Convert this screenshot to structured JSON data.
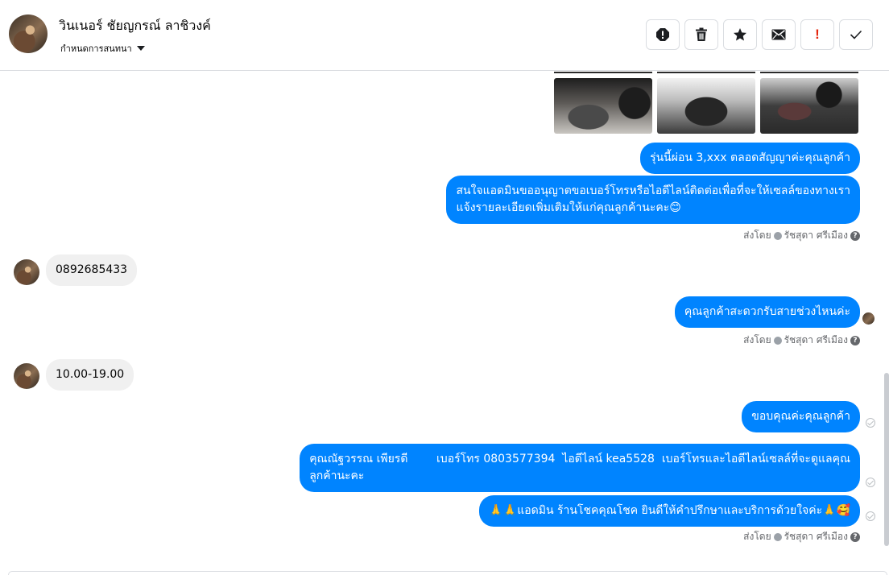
{
  "header": {
    "contact_name": "วินเนอร์ ชัยญกรณ์ ลาชิวงค์",
    "subtitle": "กำหนดการสนทนา",
    "actions": [
      {
        "name": "report-icon"
      },
      {
        "name": "trash-icon"
      },
      {
        "name": "star-icon"
      },
      {
        "name": "envelope-icon"
      },
      {
        "name": "priority-icon",
        "glyph": "!"
      },
      {
        "name": "checkmark-icon"
      }
    ]
  },
  "messages": {
    "m1": "รุ่นนี้ผ่อน 3,xxx ตลอดสัญญาค่ะคุณลูกค้า",
    "m2_line1": "สนใจแอดมินขออนุญาตขอเบอร์โทรหรือไอดีไลน์ติดต่อเพื่อที่จะให้เซลล์ของทางเรา",
    "m2_line2": "แจ้งรายละเอียดเพิ่มเติมให้แก่คุณลูกค้านะคะ😊",
    "in1": "0892685433",
    "m3": "คุณลูกค้าสะดวกรับสายช่วงไหนค่ะ",
    "in2": "10.00-19.00",
    "m4": "ขอบคุณค่ะคุณลูกค้า",
    "m5_line1": "คุณณัฐวรรณ เพียรดี        เบอร์โทร 0803577394  ไอดีไลน์ kea5528  เบอร์โทรและไอดีไลน์เซลล์ที่จะดูแลคุณ",
    "m5_line2": "ลูกค้านะคะ",
    "m6": "🙏🙏แอดมิน ร้านโชคคุณโชค ยินดีให้คำปรึกษาและบริการด้วยใจค่ะ🙏🥰"
  },
  "sent_by": {
    "prefix": "ส่งโดย",
    "agent": "รัชสุดา ศรีเมือง",
    "help": "?"
  },
  "colors": {
    "outgoing_bubble": "#0084ff",
    "incoming_bubble": "#f0f0f0",
    "priority_red": "#e4260e"
  }
}
